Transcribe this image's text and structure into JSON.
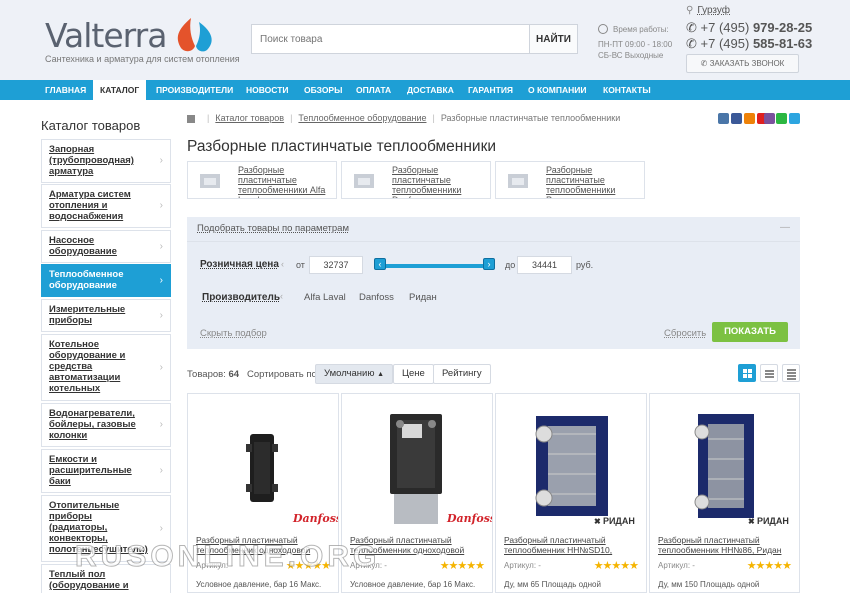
{
  "header": {
    "logo_text": "Valterra",
    "logo_tagline": "Сантехника и арматура для систем отопления",
    "search_placeholder": "Поиск товара",
    "search_button": "НАЙТИ",
    "hours_title": "Время работы:",
    "hours_weekdays": "ПН-ПТ 09:00 - 18:00",
    "hours_weekend": "СБ-ВС Выходные",
    "city": "Гурзуф",
    "phone1_prefix": "+7 (495)",
    "phone1_number": "979-28-25",
    "phone2_prefix": "+7 (495)",
    "phone2_number": "585-81-63",
    "callback": "ЗАКАЗАТЬ ЗВОНОК"
  },
  "nav": [
    "ГЛАВНАЯ",
    "КАТАЛОГ",
    "ПРОИЗВОДИТЕЛИ",
    "НОВОСТИ",
    "ОБЗОРЫ",
    "ОПЛАТА",
    "ДОСТАВКА",
    "ГАРАНТИЯ",
    "О КОМПАНИИ",
    "КОНТАКТЫ"
  ],
  "sidebar": {
    "title": "Каталог товаров",
    "items": [
      "Запорная (трубопроводная) арматура",
      "Арматура систем отопления и водоснабжения",
      "Насосное оборудование",
      "Теплообменное оборудование",
      "Измерительные приборы",
      "Котельное оборудование и средства автоматизации котельных",
      "Водонагреватели, бойлеры, газовые колонки",
      "Емкости и расширительные баки",
      "Отопительные приборы (радиаторы, конвекторы, полотенцесушители)",
      "Теплый пол (оборудование и"
    ]
  },
  "breadcrumbs": [
    "Каталог товаров",
    "Теплообменное оборудование",
    "Разборные пластинчатые теплообменники"
  ],
  "page_title": "Разборные пластинчатые теплообменники",
  "subcats": [
    "Разборные пластинчатые теплообменники Alfa Laval",
    "Разборные пластинчатые теплообменники Danfoss",
    "Разборные пластинчатые теплообменники Ридан"
  ],
  "filter": {
    "heading": "Подобрать товары по параметрам",
    "price_label": "Розничная цена",
    "from_label": "от",
    "price_from": "32737",
    "to_label": "до",
    "price_to": "34441",
    "currency": "руб.",
    "maker_label": "Производитель",
    "makers": [
      "Alfa Laval",
      "Danfoss",
      "Ридан"
    ],
    "hide": "Скрыть подбор",
    "reset": "Сбросить",
    "show": "ПОКАЗАТЬ"
  },
  "sort": {
    "count_label": "Товаров:",
    "count": "64",
    "sort_label": "Сортировать по:",
    "options": [
      "Умолчанию",
      "Цене",
      "Рейтингу"
    ]
  },
  "products": [
    {
      "name": "Разборный пластинчатый теплообменник одноходовой",
      "article": "Артикул: -",
      "stars": "★★★★★",
      "desc": "Условное давление, бар 16 Макс.",
      "brand": "Danfoss",
      "color": "#222"
    },
    {
      "name": "Разборный пластинчатый теплообменник одноходовой",
      "article": "Артикул: -",
      "stars": "★★★★★",
      "desc": "Условное давление, бар 16 Макс.",
      "brand": "Danfoss",
      "color": "#333"
    },
    {
      "name": "Разборный пластинчатый теплообменник НН№SD10,",
      "article": "Артикул: -",
      "stars": "★★★★★",
      "desc": "Ду, мм 65 Площадь одной",
      "brand": "РИДАН",
      "color": "#1c2a6b"
    },
    {
      "name": "Разборный пластинчатый теплообменник НН№86, Ридан",
      "article": "Артикул: -",
      "stars": "★★★★★",
      "desc": "Ду, мм 150 Площадь одной",
      "brand": "РИДАН",
      "color": "#1c2a6b"
    }
  ],
  "watermark": "RUSONLINE.ORG",
  "colors": {
    "accent": "#1e9fd5",
    "show_button": "#7cc142",
    "header_bg": "#eef1f7",
    "stars": "#f5b400"
  }
}
